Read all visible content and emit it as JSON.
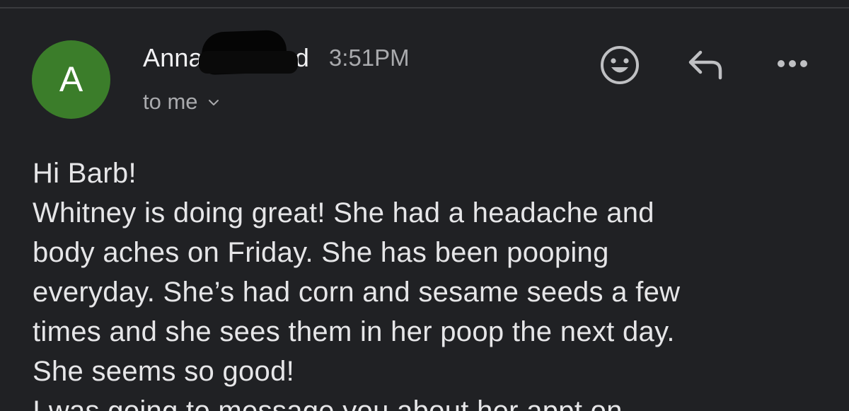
{
  "window": {
    "bg_color": "#202124"
  },
  "message": {
    "avatar_letter": "A",
    "avatar_color": "#3b7d2a",
    "sender_first": "Anna",
    "sender_trailing": "d",
    "time": "3:51PM",
    "recipient": "to me",
    "recipient_icon": "chevron-down-icon"
  },
  "actions": {
    "emoji_icon": "smiley-icon",
    "reply_icon": "reply-arrow-icon",
    "more_icon": "more-horizontal-icon"
  },
  "body": {
    "lines": [
      "Hi Barb!",
      "Whitney is doing great! She had a headache and",
      "body aches on Friday. She has been pooping",
      "everyday. She’s had corn and sesame seeds a few",
      "times and she sees them in her poop the next day.",
      "She seems so good!",
      "I was going to message you about her appt on"
    ]
  }
}
